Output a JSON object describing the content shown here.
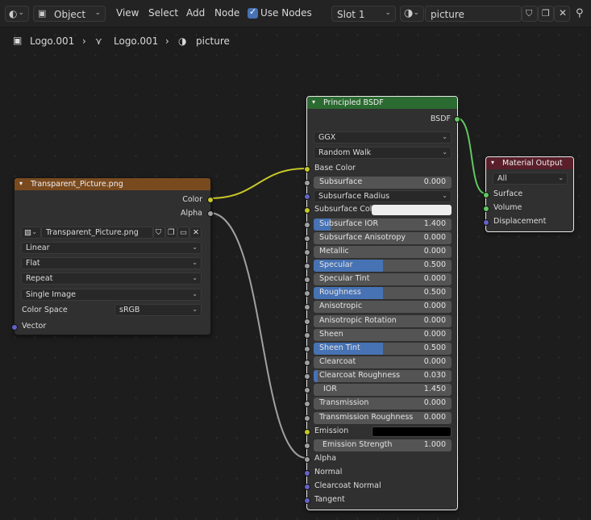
{
  "header": {
    "editor_type_icon": "node-editor-icon",
    "object_mode": "Object",
    "menu": [
      "View",
      "Select",
      "Add",
      "Node"
    ],
    "use_nodes_label": "Use Nodes",
    "use_nodes_checked": true,
    "slot": "Slot 1",
    "material_name": "picture",
    "icons": [
      "material-sphere-icon",
      "fake-user-shield-icon",
      "duplicate-icon",
      "close-icon",
      "pin-icon"
    ]
  },
  "breadcrumb": {
    "object": "Logo.001",
    "mesh": "Logo.001",
    "material": "picture"
  },
  "image_node": {
    "title": "Transparent_Picture.png",
    "header_color": "#7a4a1f",
    "outputs": [
      "Color",
      "Alpha"
    ],
    "image_name": "Transparent_Picture.png",
    "interpolation": "Linear",
    "projection": "Flat",
    "extension": "Repeat",
    "source": "Single Image",
    "color_space_label": "Color Space",
    "color_space": "sRGB",
    "vector_label": "Vector"
  },
  "bsdf_node": {
    "title": "Principled BSDF",
    "header_color": "#2b6a30",
    "output": "BSDF",
    "distribution": "GGX",
    "subsurface_method": "Random Walk",
    "base_color_label": "Base Color",
    "subsurface": {
      "label": "Subsurface",
      "value": "0.000",
      "fraction": 0
    },
    "subsurface_radius": "Subsurface Radius",
    "subsurface_color_label": "Subsurface Col...",
    "subsurface_color": "#eeeeee",
    "fields": [
      {
        "label": "Subsurface IOR",
        "value": "1.400",
        "fraction": 0.12
      },
      {
        "label": "Subsurface Anisotropy",
        "value": "0.000",
        "fraction": 0
      },
      {
        "label": "Metallic",
        "value": "0.000",
        "fraction": 0
      },
      {
        "label": "Specular",
        "value": "0.500",
        "fraction": 0.5
      },
      {
        "label": "Specular Tint",
        "value": "0.000",
        "fraction": 0
      },
      {
        "label": "Roughness",
        "value": "0.500",
        "fraction": 0.5
      },
      {
        "label": "Anisotropic",
        "value": "0.000",
        "fraction": 0
      },
      {
        "label": "Anisotropic Rotation",
        "value": "0.000",
        "fraction": 0
      },
      {
        "label": "Sheen",
        "value": "0.000",
        "fraction": 0
      },
      {
        "label": "Sheen Tint",
        "value": "0.500",
        "fraction": 0.5
      },
      {
        "label": "Clearcoat",
        "value": "0.000",
        "fraction": 0
      },
      {
        "label": "Clearcoat Roughness",
        "value": "0.030",
        "fraction": 0.03
      },
      {
        "label": "IOR",
        "value": "1.450",
        "fraction": 0
      },
      {
        "label": "Transmission",
        "value": "0.000",
        "fraction": 0
      },
      {
        "label": "Transmission Roughness",
        "value": "0.000",
        "fraction": 0
      }
    ],
    "emission_label": "Emission",
    "emission_color": "#000000",
    "emission_strength": {
      "label": "Emission Strength",
      "value": "1.000",
      "fraction": 0
    },
    "alpha_label": "Alpha",
    "normal_label": "Normal",
    "clearcoat_normal_label": "Clearcoat Normal",
    "tangent_label": "Tangent"
  },
  "output_node": {
    "title": "Material Output",
    "header_color": "#5a1f2a",
    "target": "All",
    "inputs": [
      "Surface",
      "Volume",
      "Displacement"
    ]
  },
  "colors": {
    "wire_color": "#c7c729",
    "wire_float": "#a1a1a1",
    "wire_shader": "#63c763",
    "accent": "#4772b3"
  }
}
